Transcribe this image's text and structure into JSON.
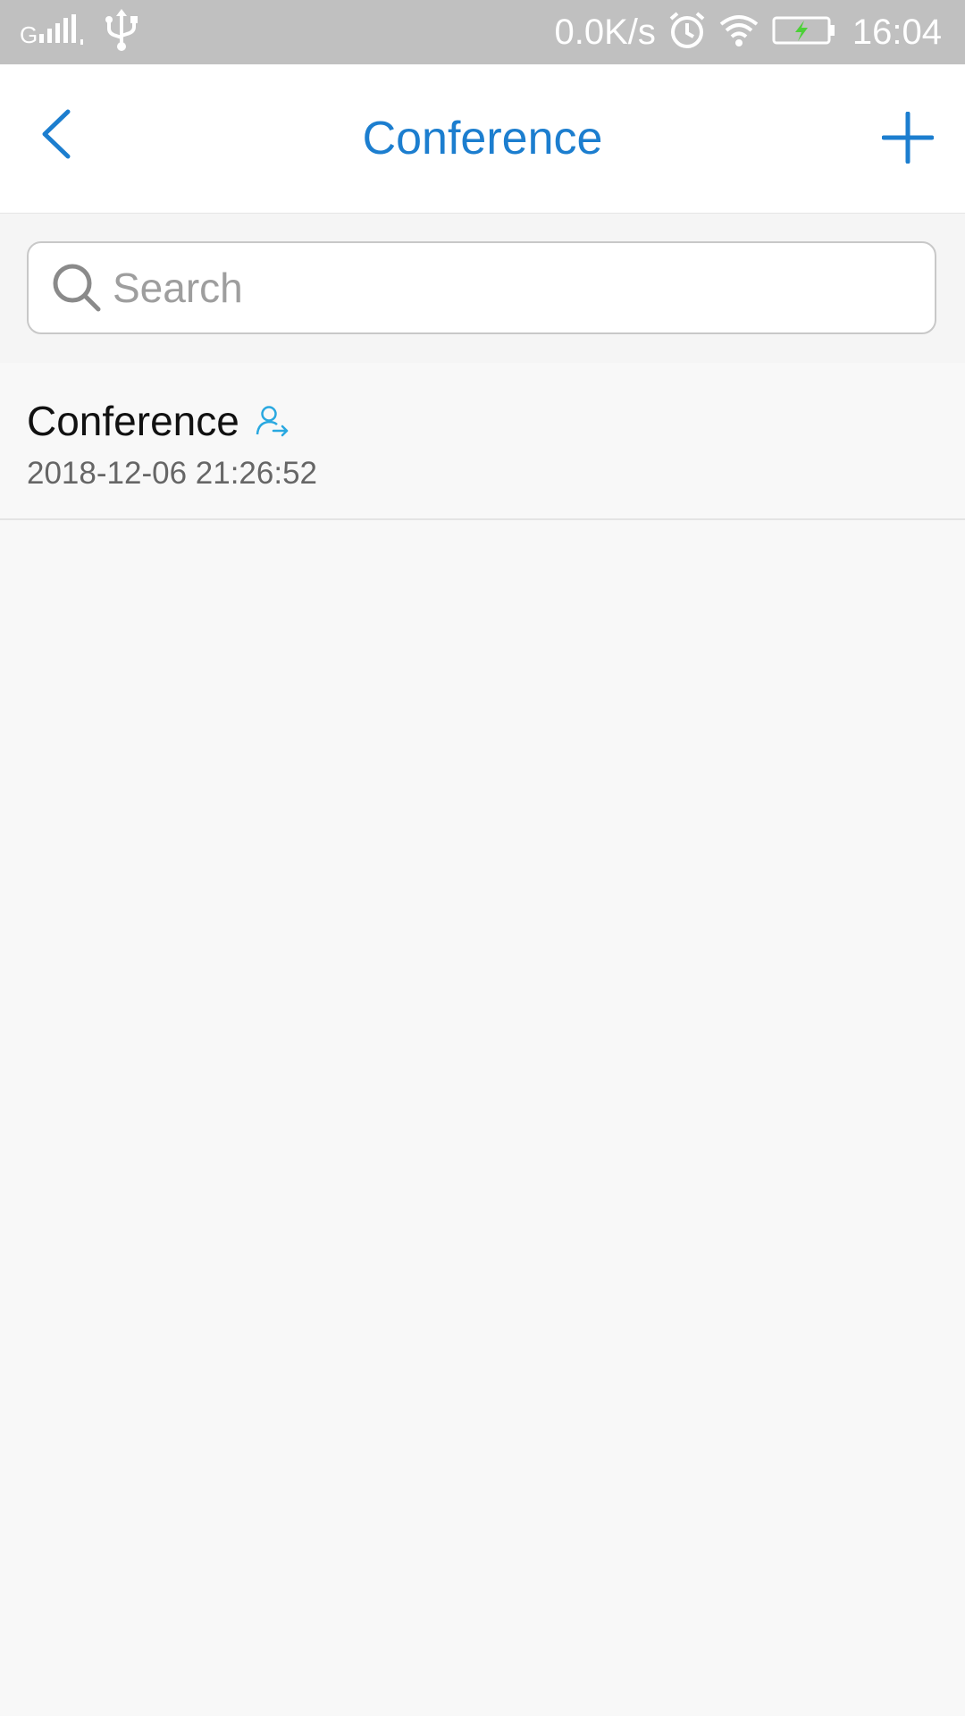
{
  "status_bar": {
    "net_speed": "0.0K/s",
    "time": "16:04",
    "icons": [
      "signal-icon",
      "usb-icon",
      "alarm-icon",
      "wifi-icon",
      "battery-charging-icon"
    ]
  },
  "header": {
    "title": "Conference",
    "back_icon": "chevron-left-icon",
    "add_icon": "plus-icon"
  },
  "search": {
    "placeholder": "Search",
    "value": "",
    "icon": "search-icon"
  },
  "conferences": [
    {
      "title": "Conference",
      "time": "2018-12-06 21:26:52",
      "icon": "user-arrow-icon"
    }
  ],
  "colors": {
    "accent": "#1c7ecf",
    "status_bar": "#c0c0c0",
    "background": "#f8f8f8",
    "item_icon": "#29a8e0",
    "battery_bolt": "#4cd137"
  }
}
